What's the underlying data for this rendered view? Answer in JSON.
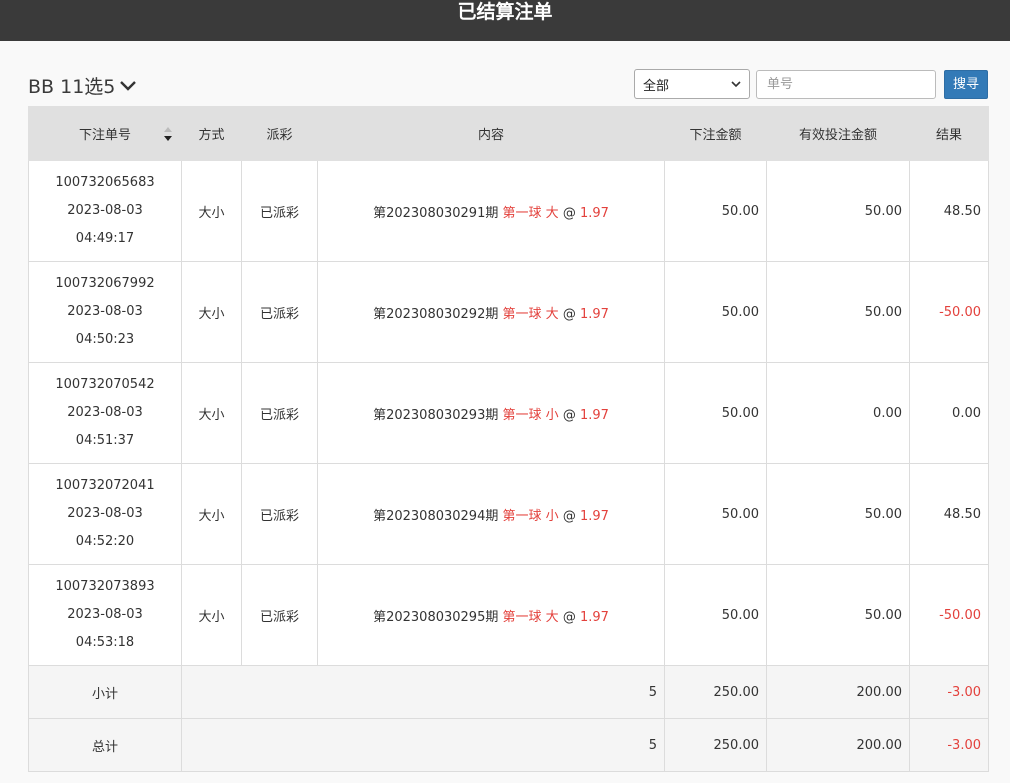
{
  "header": {
    "title": "已结算注单"
  },
  "game": {
    "name": "BB 11选5"
  },
  "filter": {
    "selected": "全部"
  },
  "search": {
    "placeholder": "单号",
    "button": "搜寻"
  },
  "columns": [
    "下注单号",
    "方式",
    "派彩",
    "内容",
    "下注金额",
    "有效投注金额",
    "结果"
  ],
  "rows": [
    {
      "id": "100732065683",
      "date": "2023-08-03",
      "time": "04:49:17",
      "method": "大小",
      "payout": "已派彩",
      "period": "第202308030291期",
      "pick_ball": "第一球",
      "pick_value": "大",
      "at": "@",
      "odds": "1.97",
      "amount": "50.00",
      "valid": "50.00",
      "result": "48.50"
    },
    {
      "id": "100732067992",
      "date": "2023-08-03",
      "time": "04:50:23",
      "method": "大小",
      "payout": "已派彩",
      "period": "第202308030292期",
      "pick_ball": "第一球",
      "pick_value": "大",
      "at": "@",
      "odds": "1.97",
      "amount": "50.00",
      "valid": "50.00",
      "result": "-50.00"
    },
    {
      "id": "100732070542",
      "date": "2023-08-03",
      "time": "04:51:37",
      "method": "大小",
      "payout": "已派彩",
      "period": "第202308030293期",
      "pick_ball": "第一球",
      "pick_value": "小",
      "at": "@",
      "odds": "1.97",
      "amount": "50.00",
      "valid": "0.00",
      "result": "0.00"
    },
    {
      "id": "100732072041",
      "date": "2023-08-03",
      "time": "04:52:20",
      "method": "大小",
      "payout": "已派彩",
      "period": "第202308030294期",
      "pick_ball": "第一球",
      "pick_value": "小",
      "at": "@",
      "odds": "1.97",
      "amount": "50.00",
      "valid": "50.00",
      "result": "48.50"
    },
    {
      "id": "100732073893",
      "date": "2023-08-03",
      "time": "04:53:18",
      "method": "大小",
      "payout": "已派彩",
      "period": "第202308030295期",
      "pick_ball": "第一球",
      "pick_value": "大",
      "at": "@",
      "odds": "1.97",
      "amount": "50.00",
      "valid": "50.00",
      "result": "-50.00"
    }
  ],
  "subtotal": {
    "label": "小计",
    "count": "5",
    "amount": "250.00",
    "valid": "200.00",
    "result": "-3.00"
  },
  "total": {
    "label": "总计",
    "count": "5",
    "amount": "250.00",
    "valid": "200.00",
    "result": "-3.00"
  },
  "colors": {
    "topbar": "#3a3a3a",
    "accent": "#337ab7",
    "negative": "#e3413c"
  },
  "icons": {
    "game_dropdown": "chevron-down-icon",
    "select_caret": "caret-down-icon",
    "sort": "sort-icon"
  }
}
